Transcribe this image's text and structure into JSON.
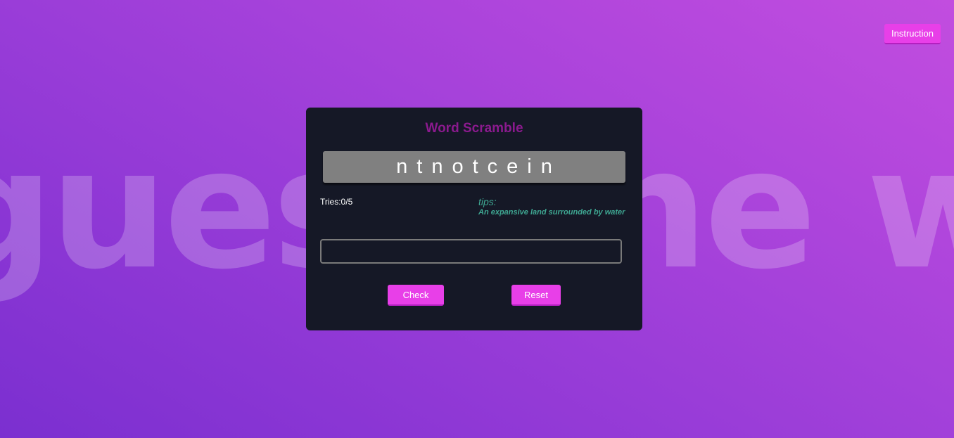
{
  "background": {
    "watermark_text": "guess the word"
  },
  "header": {
    "instruction_label": "Instruction"
  },
  "game": {
    "title": "Word Scramble",
    "scrambled_word": "ntnotcein",
    "tries_label": "Tries:",
    "tries_value": "0/5",
    "tries_display": "Tries:0/5",
    "tips_label": "tips:",
    "tip_text": "An expansive land surrounded by water",
    "guess_value": "",
    "guess_placeholder": "",
    "check_label": "Check",
    "reset_label": "Reset"
  },
  "colors": {
    "accent": "#e83fe8",
    "title": "#8b1a8e",
    "card_bg": "#151826",
    "tip": "#3fa893",
    "word_box": "#808080"
  }
}
